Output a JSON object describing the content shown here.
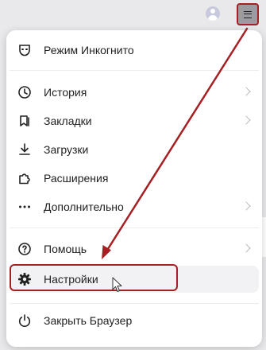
{
  "menu": {
    "items": [
      {
        "label": "Режим Инкогнито",
        "icon": "incognito-mask-icon",
        "chevron": false
      },
      {
        "label": "История",
        "icon": "clock-icon",
        "chevron": true
      },
      {
        "label": "Закладки",
        "icon": "bookmarks-icon",
        "chevron": true
      },
      {
        "label": "Загрузки",
        "icon": "download-icon",
        "chevron": false
      },
      {
        "label": "Расширения",
        "icon": "puzzle-icon",
        "chevron": false
      },
      {
        "label": "Дополнительно",
        "icon": "more-dots-icon",
        "chevron": true
      },
      {
        "label": "Помощь",
        "icon": "help-icon",
        "chevron": true
      },
      {
        "label": "Настройки",
        "icon": "gear-icon",
        "chevron": false
      },
      {
        "label": "Закрыть Браузер",
        "icon": "power-icon",
        "chevron": false
      }
    ]
  },
  "colors": {
    "highlight": "#a51f23",
    "hover_bg": "#f2f2f4"
  }
}
